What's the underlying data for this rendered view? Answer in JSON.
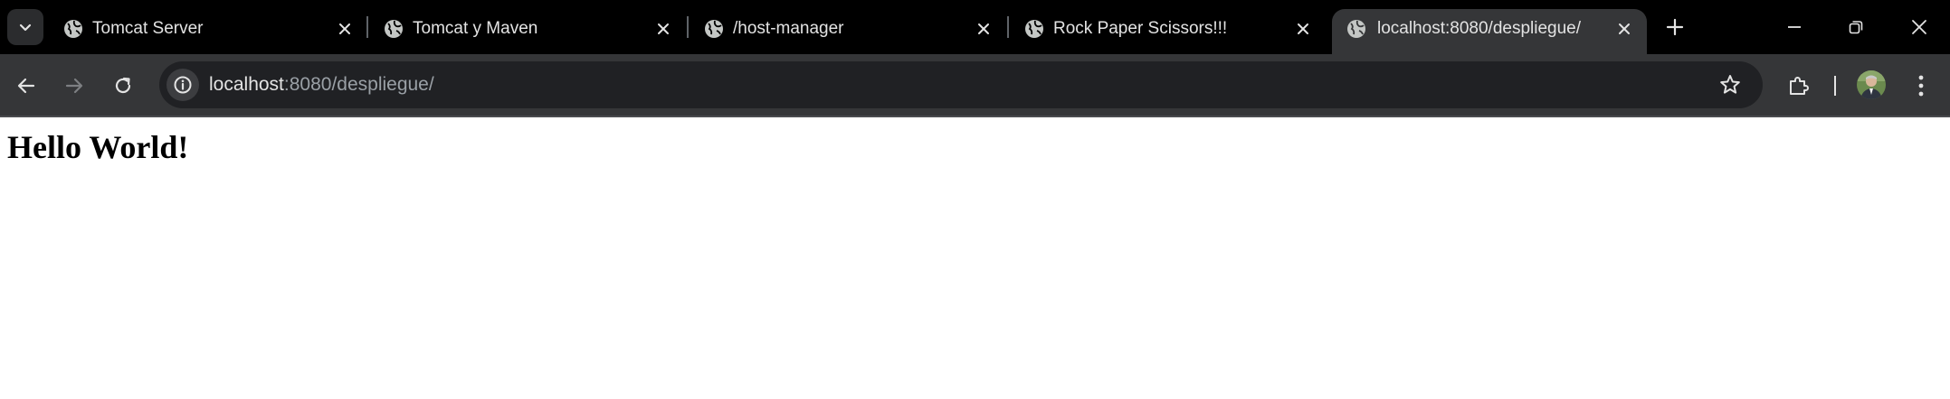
{
  "tabs": [
    {
      "title": "Tomcat Server",
      "active": false
    },
    {
      "title": "Tomcat y Maven",
      "active": false
    },
    {
      "title": "/host-manager",
      "active": false
    },
    {
      "title": "Rock Paper Scissors!!!",
      "active": false
    },
    {
      "title": "localhost:8080/despliegue/",
      "active": true
    }
  ],
  "address_bar": {
    "host": "localhost",
    "path": ":8080/despliegue/"
  },
  "page": {
    "heading": "Hello World!"
  },
  "icons": {
    "tab_search": "chevron-down-icon",
    "tab_favicon": "globe-icon",
    "tab_close": "close-icon",
    "new_tab": "plus-icon",
    "minimize": "minimize-icon",
    "restore": "restore-icon",
    "close_window": "close-icon",
    "back": "arrow-left-icon",
    "forward": "arrow-right-icon",
    "reload": "reload-icon",
    "site_info": "info-icon",
    "bookmark": "star-icon",
    "extensions": "puzzle-icon",
    "menu": "kebab-menu-icon"
  },
  "colors": {
    "tabstrip_bg": "#000000",
    "active_tab_bg": "#353638",
    "toolbar_bg": "#353638",
    "omnibox_bg": "#202124",
    "text_primary": "#e3e3e3",
    "text_secondary": "#9aa0a6"
  }
}
